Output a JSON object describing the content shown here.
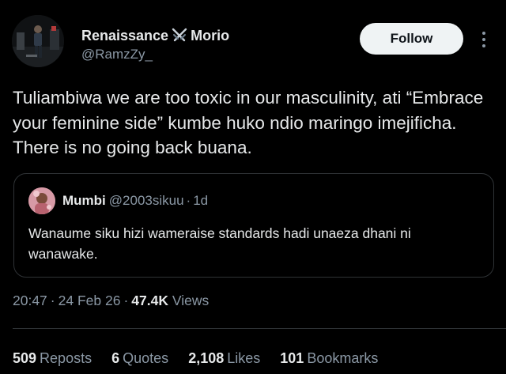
{
  "author": {
    "display_name_part1": "Renaissance",
    "display_name_emoji": "crossed-swords-icon",
    "display_name_part2": "Morio",
    "handle": "@RamzZy_"
  },
  "follow_button": {
    "label": "Follow"
  },
  "more_menu": {
    "icon": "more-vertical-icon"
  },
  "tweet": {
    "text": "Tuliambiwa we are too toxic in our masculinity, ati “Embrace your feminine side” kumbe huko ndio maringo imejificha. There is no going back buana."
  },
  "quote": {
    "name": "Mumbi",
    "handle": "@2003sikuu",
    "dot": "·",
    "time": "1d",
    "text": "Wanaume siku hizi wameraise standards hadi unaeza dhani ni wanawake."
  },
  "meta": {
    "time": "20:47",
    "sep1": "·",
    "date": "24 Feb 26",
    "sep2": "·",
    "views_count": "47.4K",
    "views_label": "Views"
  },
  "stats": [
    {
      "count": "509",
      "label": "Reposts"
    },
    {
      "count": "6",
      "label": "Quotes"
    },
    {
      "count": "2,108",
      "label": "Likes"
    },
    {
      "count": "101",
      "label": "Bookmarks"
    }
  ],
  "colors": {
    "background": "#000000",
    "primary_text": "#e7e9ea",
    "secondary_text": "#8b98a5",
    "border": "#2f3336",
    "follow_button_bg": "#eff3f4"
  }
}
